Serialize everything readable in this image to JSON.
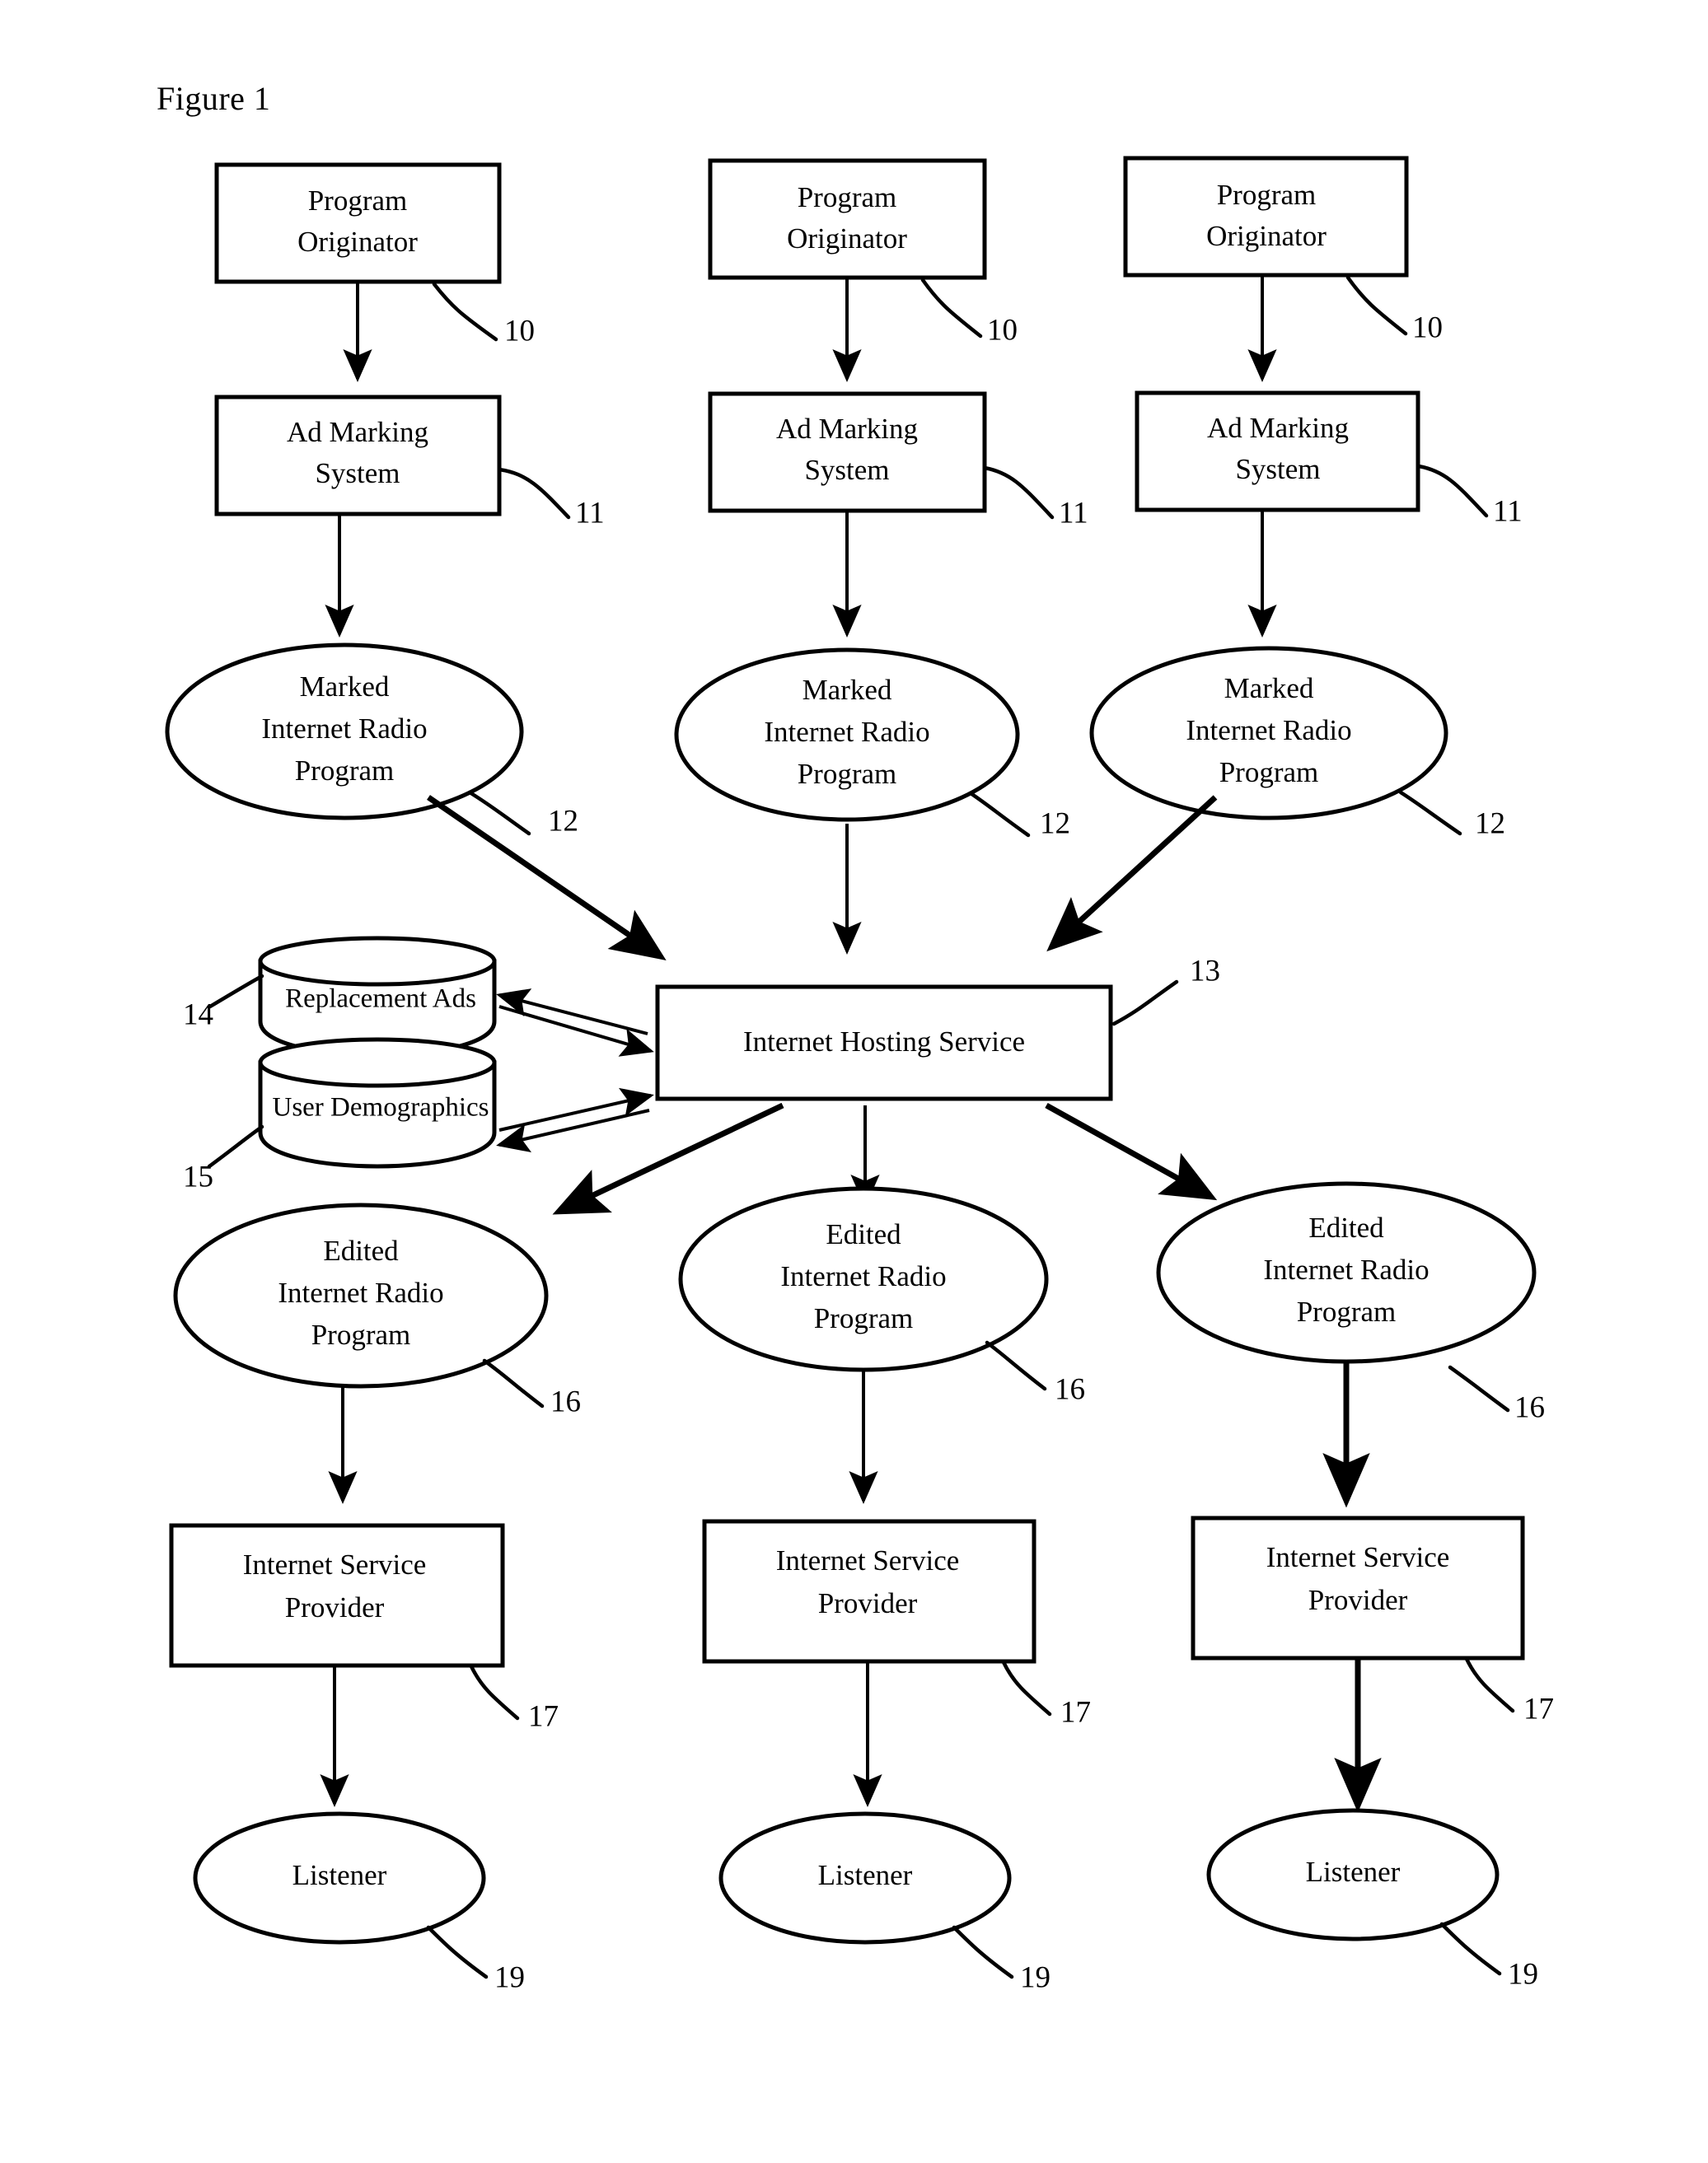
{
  "figure": {
    "title": "Figure 1"
  },
  "nodes": {
    "program_originator": "Program Originator",
    "program_originator_line1": "Program",
    "program_originator_line2": "Originator",
    "ad_marking_system_line1": "Ad Marking",
    "ad_marking_system_line2": "System",
    "marked_program_line1": "Marked",
    "marked_program_line2": "Internet Radio",
    "marked_program_line3": "Program",
    "replacement_ads": "Replacement Ads",
    "user_demographics": "User Demographics",
    "internet_hosting_service": "Internet Hosting Service",
    "edited_program_line1": "Edited",
    "edited_program_line2": "Internet Radio",
    "edited_program_line3": "Program",
    "isp_line1": "Internet Service",
    "isp_line2": "Provider",
    "listener": "Listener"
  },
  "reference_numerals": {
    "program_originator": "10",
    "ad_marking_system": "11",
    "marked_program": "12",
    "internet_hosting_service": "13",
    "replacement_ads": "14",
    "user_demographics": "15",
    "edited_program": "16",
    "internet_service_provider": "17",
    "listener": "19"
  },
  "columns": [
    {
      "index": 1,
      "program_originator": "Program Originator",
      "ad_marking_system": "Ad Marking System",
      "marked_program": "Marked Internet Radio Program",
      "edited_program": "Edited Internet Radio Program",
      "isp": "Internet Service Provider",
      "listener": "Listener",
      "refs": [
        "10",
        "11",
        "12",
        "16",
        "17",
        "19"
      ]
    },
    {
      "index": 2,
      "program_originator": "Program Originator",
      "ad_marking_system": "Ad Marking System",
      "marked_program": "Marked Internet Radio Program",
      "edited_program": "Edited Internet Radio Program",
      "isp": "Internet Service Provider",
      "listener": "Listener",
      "refs": [
        "10",
        "11",
        "12",
        "16",
        "17",
        "19"
      ]
    },
    {
      "index": 3,
      "program_originator": "Program Originator",
      "ad_marking_system": "Ad Marking System",
      "marked_program": "Marked Internet Radio Program",
      "edited_program": "Edited Internet Radio Program",
      "isp": "Internet Service Provider",
      "listener": "Listener",
      "refs": [
        "10",
        "11",
        "12",
        "16",
        "17",
        "19"
      ]
    }
  ],
  "databases": [
    {
      "label": "Replacement Ads",
      "ref": "14"
    },
    {
      "label": "User Demographics",
      "ref": "15"
    }
  ],
  "colors": {
    "ink": "#000000",
    "paper": "#ffffff"
  }
}
